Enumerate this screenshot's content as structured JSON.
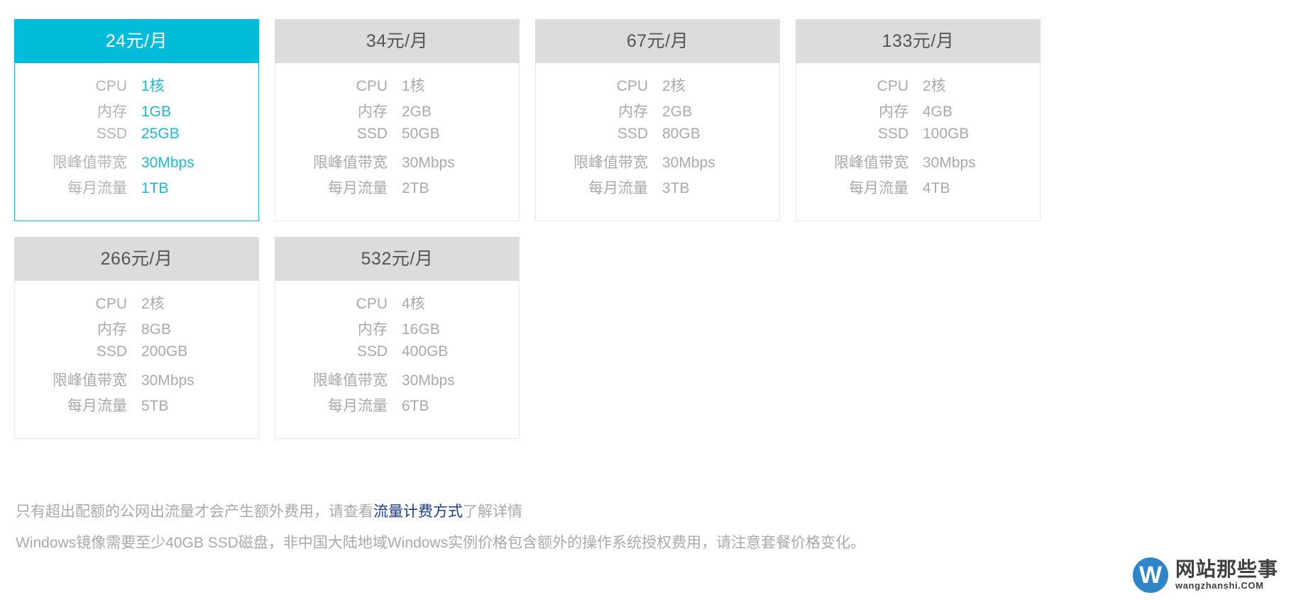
{
  "colors": {
    "accent": "#00bcd9",
    "accent_border": "#19b6d0",
    "accent_value_text": "#1cb9d4",
    "header_gray": "#dcdcdc",
    "body_text_gray": "#a9a9a9",
    "link_navy": "#1a3a8f",
    "watermark_blue": "#2e86c8"
  },
  "spec_labels": {
    "cpu": "CPU",
    "memory": "内存",
    "ssd": "SSD",
    "bandwidth": "限峰值带宽",
    "traffic": "每月流量"
  },
  "plans": [
    {
      "price": "24元/月",
      "selected": true,
      "cpu": "1核",
      "memory": "1GB",
      "ssd": "25GB",
      "bandwidth": "30Mbps",
      "traffic": "1TB"
    },
    {
      "price": "34元/月",
      "selected": false,
      "cpu": "1核",
      "memory": "2GB",
      "ssd": "50GB",
      "bandwidth": "30Mbps",
      "traffic": "2TB"
    },
    {
      "price": "67元/月",
      "selected": false,
      "cpu": "2核",
      "memory": "2GB",
      "ssd": "80GB",
      "bandwidth": "30Mbps",
      "traffic": "3TB"
    },
    {
      "price": "133元/月",
      "selected": false,
      "cpu": "2核",
      "memory": "4GB",
      "ssd": "100GB",
      "bandwidth": "30Mbps",
      "traffic": "4TB"
    },
    {
      "price": "266元/月",
      "selected": false,
      "cpu": "2核",
      "memory": "8GB",
      "ssd": "200GB",
      "bandwidth": "30Mbps",
      "traffic": "5TB"
    },
    {
      "price": "532元/月",
      "selected": false,
      "cpu": "4核",
      "memory": "16GB",
      "ssd": "400GB",
      "bandwidth": "30Mbps",
      "traffic": "6TB"
    }
  ],
  "notes": {
    "line1_prefix": "只有超出配额的公网出流量才会产生额外费用，请查看",
    "line1_link": "流量计费方式",
    "line1_suffix": "了解详情",
    "line2": "Windows镜像需要至少40GB SSD磁盘，非中国大陆地域Windows实例价格包含额外的操作系统授权费用，请注意套餐价格变化。"
  },
  "watermark": {
    "badge_letter": "W",
    "site_name_cn": "网站那些事",
    "site_name_en": "wangzhanshi.COM"
  }
}
